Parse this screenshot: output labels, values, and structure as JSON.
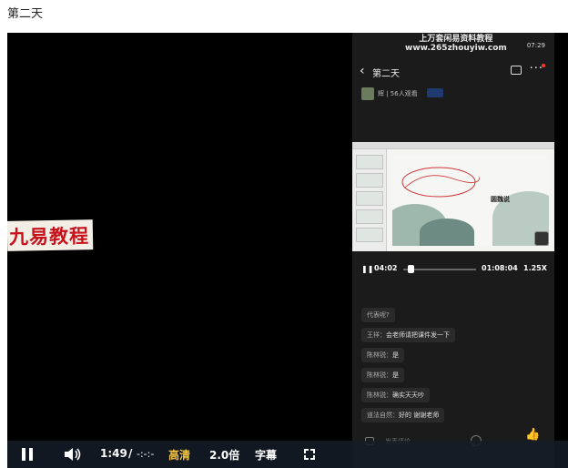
{
  "page": {
    "title": "第二天"
  },
  "watermark": {
    "text": "九易教程"
  },
  "phone": {
    "site_watermark_line1": "上万套闲易资料教程",
    "site_watermark_line2": "www.265zhouyiw.com",
    "status_time": "07:29",
    "header_title": "第二天",
    "host_text": "辉 | 56人观看",
    "slide_title": "圆魏说",
    "current_time": "04:02",
    "total_time": "01:08:04",
    "speed": "1.25X",
    "playback_progress": 0.06,
    "comments": [
      {
        "name": "代表呢?",
        "text": ""
      },
      {
        "name": "王祥：",
        "text": "会老师请把课件发一下"
      },
      {
        "name": "陈林锐：",
        "text": "是"
      },
      {
        "name": "陈林锐：",
        "text": "是"
      },
      {
        "name": "陈林锐：",
        "text": "确实天天吵"
      },
      {
        "name": "道法自然：",
        "text": "好的 谢谢老师"
      }
    ],
    "input_placeholder": "发表评论"
  },
  "controls": {
    "current_time": "1:49",
    "separator": "/",
    "duration": "-:-:-",
    "quality": "高清",
    "speed": "2.0倍",
    "subtitle": "字幕"
  },
  "colors": {
    "quality_accent": "#f5c542",
    "watermark_red": "#c8121b"
  }
}
